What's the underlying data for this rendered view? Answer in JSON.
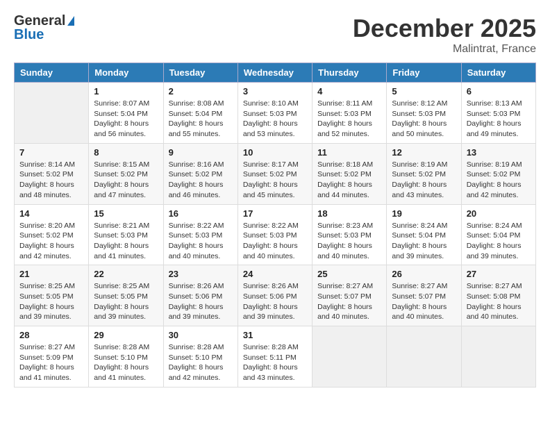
{
  "header": {
    "logo_general": "General",
    "logo_blue": "Blue",
    "month": "December 2025",
    "location": "Malintrat, France"
  },
  "weekdays": [
    "Sunday",
    "Monday",
    "Tuesday",
    "Wednesday",
    "Thursday",
    "Friday",
    "Saturday"
  ],
  "weeks": [
    [
      {
        "day": "",
        "info": ""
      },
      {
        "day": "1",
        "info": "Sunrise: 8:07 AM\nSunset: 5:04 PM\nDaylight: 8 hours\nand 56 minutes."
      },
      {
        "day": "2",
        "info": "Sunrise: 8:08 AM\nSunset: 5:04 PM\nDaylight: 8 hours\nand 55 minutes."
      },
      {
        "day": "3",
        "info": "Sunrise: 8:10 AM\nSunset: 5:03 PM\nDaylight: 8 hours\nand 53 minutes."
      },
      {
        "day": "4",
        "info": "Sunrise: 8:11 AM\nSunset: 5:03 PM\nDaylight: 8 hours\nand 52 minutes."
      },
      {
        "day": "5",
        "info": "Sunrise: 8:12 AM\nSunset: 5:03 PM\nDaylight: 8 hours\nand 50 minutes."
      },
      {
        "day": "6",
        "info": "Sunrise: 8:13 AM\nSunset: 5:03 PM\nDaylight: 8 hours\nand 49 minutes."
      }
    ],
    [
      {
        "day": "7",
        "info": "Sunrise: 8:14 AM\nSunset: 5:02 PM\nDaylight: 8 hours\nand 48 minutes."
      },
      {
        "day": "8",
        "info": "Sunrise: 8:15 AM\nSunset: 5:02 PM\nDaylight: 8 hours\nand 47 minutes."
      },
      {
        "day": "9",
        "info": "Sunrise: 8:16 AM\nSunset: 5:02 PM\nDaylight: 8 hours\nand 46 minutes."
      },
      {
        "day": "10",
        "info": "Sunrise: 8:17 AM\nSunset: 5:02 PM\nDaylight: 8 hours\nand 45 minutes."
      },
      {
        "day": "11",
        "info": "Sunrise: 8:18 AM\nSunset: 5:02 PM\nDaylight: 8 hours\nand 44 minutes."
      },
      {
        "day": "12",
        "info": "Sunrise: 8:19 AM\nSunset: 5:02 PM\nDaylight: 8 hours\nand 43 minutes."
      },
      {
        "day": "13",
        "info": "Sunrise: 8:19 AM\nSunset: 5:02 PM\nDaylight: 8 hours\nand 42 minutes."
      }
    ],
    [
      {
        "day": "14",
        "info": "Sunrise: 8:20 AM\nSunset: 5:02 PM\nDaylight: 8 hours\nand 42 minutes."
      },
      {
        "day": "15",
        "info": "Sunrise: 8:21 AM\nSunset: 5:03 PM\nDaylight: 8 hours\nand 41 minutes."
      },
      {
        "day": "16",
        "info": "Sunrise: 8:22 AM\nSunset: 5:03 PM\nDaylight: 8 hours\nand 40 minutes."
      },
      {
        "day": "17",
        "info": "Sunrise: 8:22 AM\nSunset: 5:03 PM\nDaylight: 8 hours\nand 40 minutes."
      },
      {
        "day": "18",
        "info": "Sunrise: 8:23 AM\nSunset: 5:03 PM\nDaylight: 8 hours\nand 40 minutes."
      },
      {
        "day": "19",
        "info": "Sunrise: 8:24 AM\nSunset: 5:04 PM\nDaylight: 8 hours\nand 39 minutes."
      },
      {
        "day": "20",
        "info": "Sunrise: 8:24 AM\nSunset: 5:04 PM\nDaylight: 8 hours\nand 39 minutes."
      }
    ],
    [
      {
        "day": "21",
        "info": "Sunrise: 8:25 AM\nSunset: 5:05 PM\nDaylight: 8 hours\nand 39 minutes."
      },
      {
        "day": "22",
        "info": "Sunrise: 8:25 AM\nSunset: 5:05 PM\nDaylight: 8 hours\nand 39 minutes."
      },
      {
        "day": "23",
        "info": "Sunrise: 8:26 AM\nSunset: 5:06 PM\nDaylight: 8 hours\nand 39 minutes."
      },
      {
        "day": "24",
        "info": "Sunrise: 8:26 AM\nSunset: 5:06 PM\nDaylight: 8 hours\nand 39 minutes."
      },
      {
        "day": "25",
        "info": "Sunrise: 8:27 AM\nSunset: 5:07 PM\nDaylight: 8 hours\nand 40 minutes."
      },
      {
        "day": "26",
        "info": "Sunrise: 8:27 AM\nSunset: 5:07 PM\nDaylight: 8 hours\nand 40 minutes."
      },
      {
        "day": "27",
        "info": "Sunrise: 8:27 AM\nSunset: 5:08 PM\nDaylight: 8 hours\nand 40 minutes."
      }
    ],
    [
      {
        "day": "28",
        "info": "Sunrise: 8:27 AM\nSunset: 5:09 PM\nDaylight: 8 hours\nand 41 minutes."
      },
      {
        "day": "29",
        "info": "Sunrise: 8:28 AM\nSunset: 5:10 PM\nDaylight: 8 hours\nand 41 minutes."
      },
      {
        "day": "30",
        "info": "Sunrise: 8:28 AM\nSunset: 5:10 PM\nDaylight: 8 hours\nand 42 minutes."
      },
      {
        "day": "31",
        "info": "Sunrise: 8:28 AM\nSunset: 5:11 PM\nDaylight: 8 hours\nand 43 minutes."
      },
      {
        "day": "",
        "info": ""
      },
      {
        "day": "",
        "info": ""
      },
      {
        "day": "",
        "info": ""
      }
    ]
  ]
}
